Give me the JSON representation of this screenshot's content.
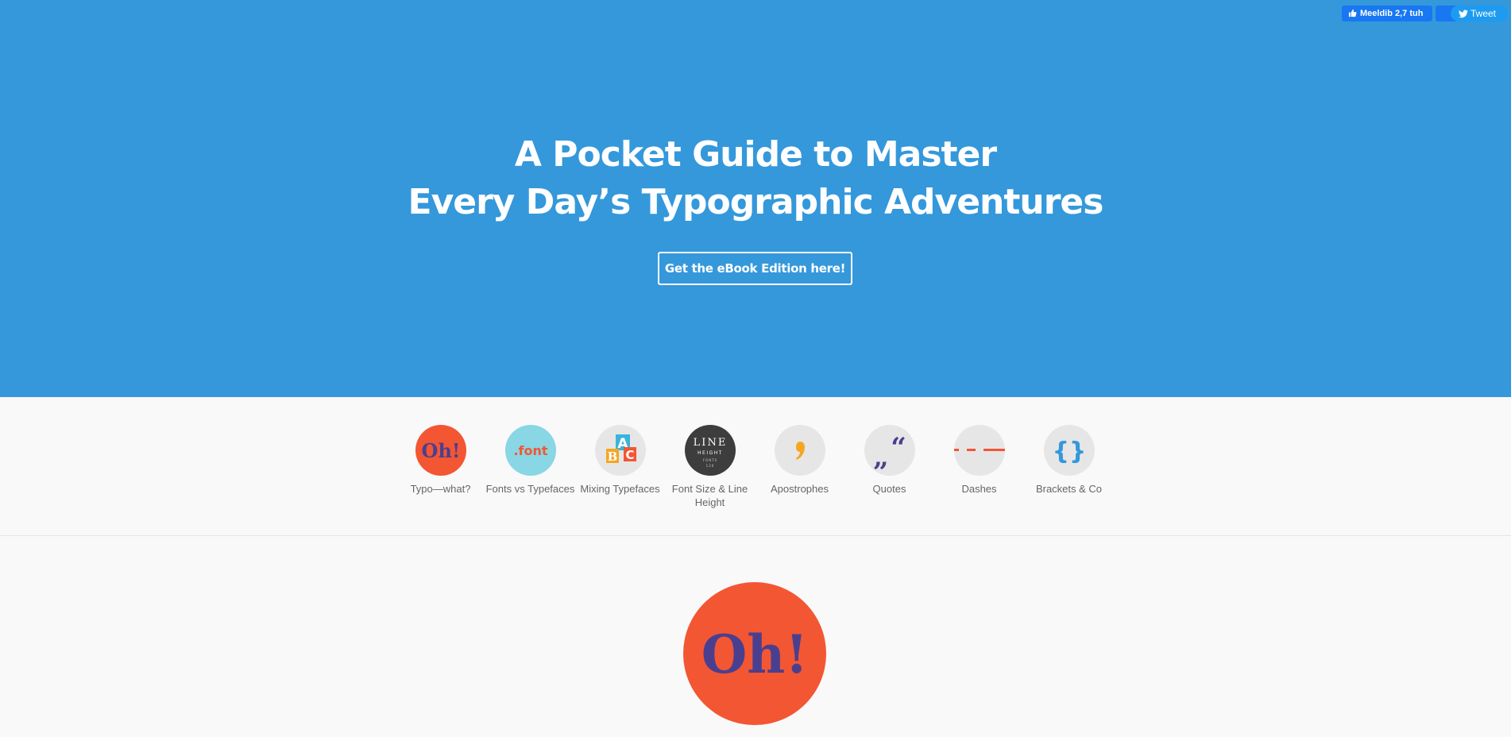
{
  "social": {
    "like_label": "Meeldib 2,7 tuh",
    "tweet_label": "Tweet",
    "like_icon": "thumbs-up-icon",
    "tweet_icon": "twitter-bird-icon"
  },
  "hero": {
    "title_line1": "A Pocket Guide to Master",
    "title_line2": "Every Day’s Typographic Adventures",
    "cta_label": "Get the eBook Edition here!",
    "background_color": "#3498db"
  },
  "nav": {
    "items": [
      {
        "label": "Typo—what?",
        "icon": "oh-exclamation-icon",
        "icon_text": "Oh!"
      },
      {
        "label": "Fonts vs Typefaces",
        "icon": "font-extension-icon",
        "icon_text": ".font"
      },
      {
        "label": "Mixing Typefaces",
        "icon": "abc-blocks-icon",
        "icon_text": "ABC"
      },
      {
        "label": "Font Size & Line Height",
        "icon": "line-height-icon",
        "icon_text_1": "LINE",
        "icon_text_2": "HEIGHT",
        "icon_text_3": "FONTS",
        "icon_text_4": "120"
      },
      {
        "label": "Apostrophes",
        "icon": "apostrophe-icon",
        "icon_text": "’"
      },
      {
        "label": "Quotes",
        "icon": "quotes-icon",
        "icon_text": "„“"
      },
      {
        "label": "Dashes",
        "icon": "dashes-icon"
      },
      {
        "label": "Brackets & Co",
        "icon": "curly-brackets-icon",
        "icon_text": "{}"
      }
    ]
  },
  "section": {
    "hero_icon": "oh-exclamation-icon",
    "hero_icon_text": "Oh!"
  },
  "colors": {
    "orange_red": "#f35633",
    "purple": "#4a3f8f",
    "light_cyan": "#89d6e4",
    "dark_gray": "#3d3d3d",
    "yellow": "#f5a623",
    "blue": "#3498db"
  }
}
